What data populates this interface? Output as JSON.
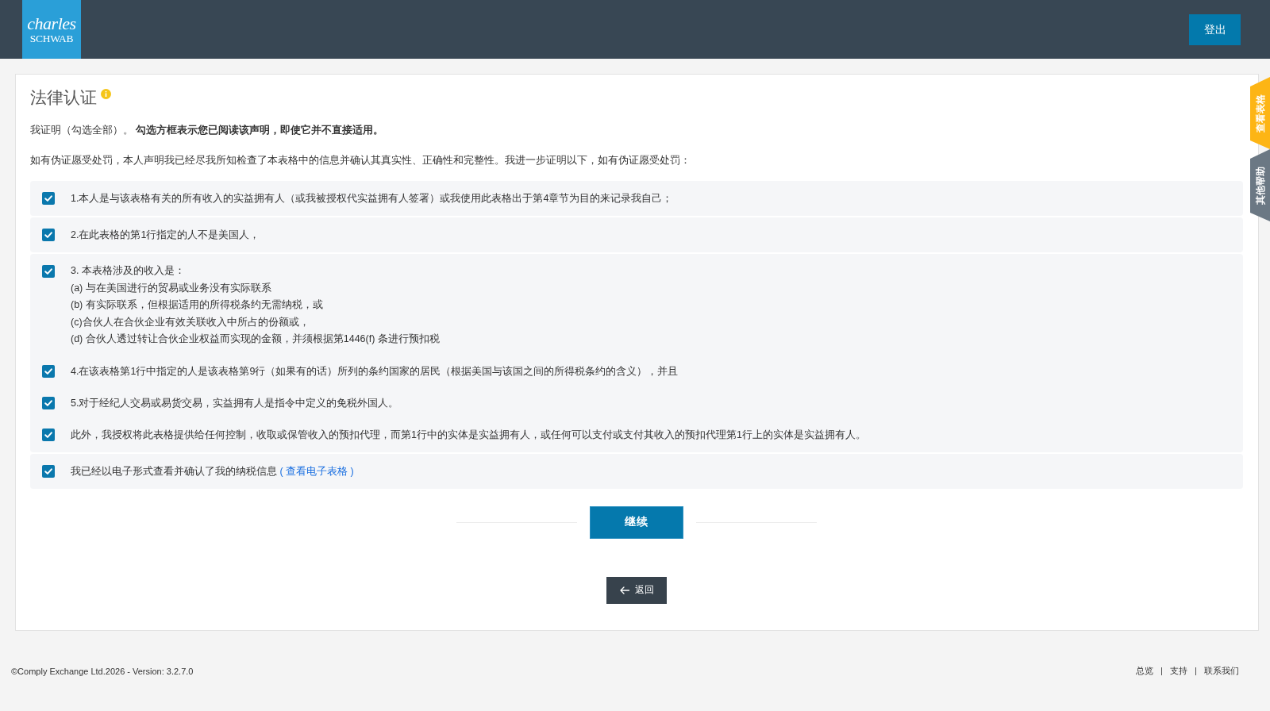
{
  "header": {
    "logo": {
      "line_1": "charles",
      "line_2": "SCHWAB"
    },
    "logout_button": "登出"
  },
  "side_tabs": [
    {
      "label": "查看表格",
      "color": "#fdb515"
    },
    {
      "label": "其他帮助",
      "color": "#6b7884"
    }
  ],
  "card": {
    "title": "法律认证",
    "intro": "我证明（勾选全部）。 **勾选方框表示您已阅读该声明，即使它并不直接适用。**",
    "statement": "如有伪证愿受处罚，本人声明我已经尽我所知检查了本表格中的信息并确认其真实性、正确性和完整性。我进一步证明以下，如有伪证愿受处罚：",
    "certification_groups": [
      {
        "items": [
          {
            "text": "1.本人是与该表格有关的所有收入的实益拥有人（或我被授权代实益拥有人签署）或我使用此表格出于第4章节为目的来记录我自己；",
            "checked": true
          }
        ]
      },
      {
        "items": [
          {
            "text": "2.在此表格的第1行指定的人不是美国人，",
            "checked": true
          }
        ]
      },
      {
        "items": [
          {
            "text": "3. 本表格涉及的收入是：\n(a) 与在美国进行的贸易或业务没有实际联系\n(b) 有实际联系，但根据适用的所得税条约无需纳税，或\n(c)合伙人在合伙企业有效关联收入中所占的份额或，\n(d) 合伙人透过转让合伙企业权益而实现的金额，并须根据第1446(f) 条进行预扣税",
            "checked": true
          },
          {
            "text": "4.在该表格第1行中指定的人是该表格第9行（如果有的话）所列的条约国家的居民（根据美国与该国之间的所得税条约的含义），并且",
            "checked": true
          },
          {
            "text": "5.对于经纪人交易或易货交易，实益拥有人是指令中定义的免税外国人。",
            "checked": true
          },
          {
            "text": "此外，我授权将此表格提供给任何控制，收取或保管收入的预扣代理，而第1行中的实体是实益拥有人，或任何可以支付或支付其收入的预扣代理第1行上的实体是实益拥有人。",
            "checked": true
          }
        ]
      },
      {
        "items": [
          {
            "text": "我已经以电子形式查看并确认了我的纳税信息",
            "link": "( 查看电子表格 )",
            "checked": true
          }
        ]
      }
    ],
    "continue_button": "继续",
    "back_button": "返回"
  },
  "footer": {
    "copyright": "©Comply Exchange Ltd.2026 - Version: 3.2.7.0",
    "links": [
      "总览",
      "支持",
      "联系我们"
    ]
  }
}
